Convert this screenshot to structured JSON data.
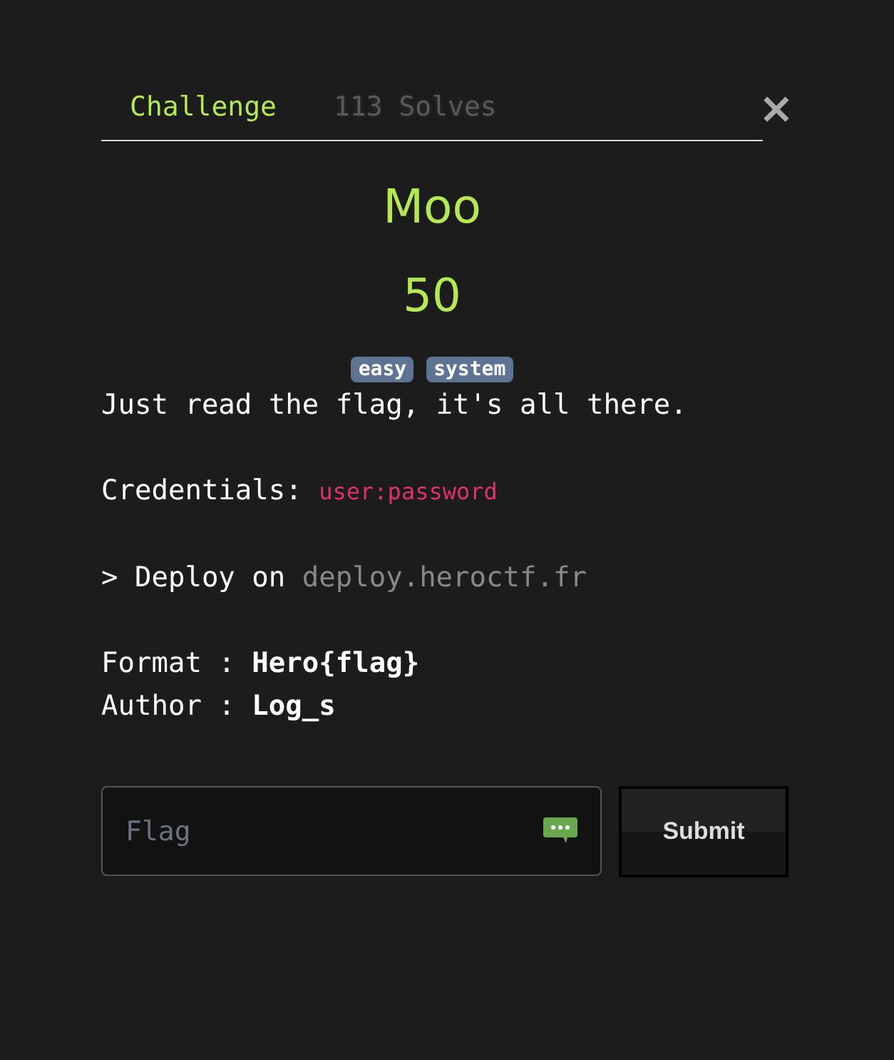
{
  "tabs": [
    {
      "label": "Challenge",
      "selected": true
    },
    {
      "label": "113 Solves",
      "selected": false
    }
  ],
  "close": {
    "label": "×"
  },
  "challenge": {
    "name": "Moo",
    "points": "50",
    "tags": [
      "easy",
      "system"
    ]
  },
  "description": [
    {
      "kind": "text",
      "text": "Just read the flag, it's all there."
    },
    {
      "kind": "code",
      "text": "Credentials:",
      "code": "user:password"
    },
    {
      "kind": "host",
      "text": "> Deploy on",
      "code": "deploy.heroctf.fr"
    },
    {
      "kind": "meta",
      "text": "Format : **Hero{flag}**\nAuthor : **Log_s**"
    }
  ],
  "flag_input": {
    "placeholder": "Flag"
  },
  "submit": {
    "label": "Submit"
  }
}
